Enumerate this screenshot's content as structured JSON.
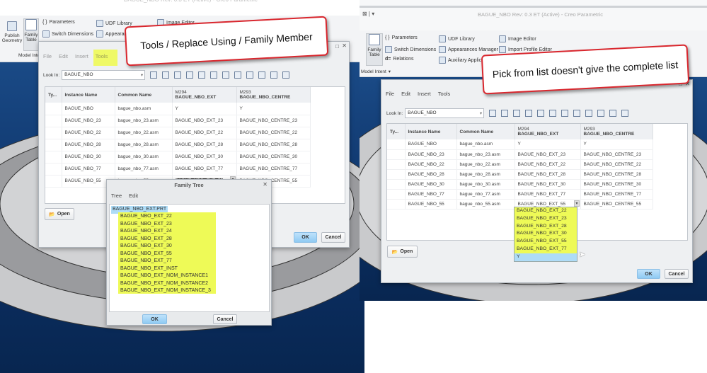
{
  "window_title": "BAGUE_NBO Rev: 0.3 ET (Active) - Creo Parametric",
  "ribbon": {
    "publish_geometry": "Publish Geometry",
    "family_table": "Family Table",
    "parameters": "Parameters",
    "switch_dimensions": "Switch Dimensions",
    "relations": "Relations",
    "udf_library": "UDF Library",
    "appearances_manager": "Appearances Manager",
    "appearances_short": "Appearan",
    "auxiliary_applications": "Auxiliary Applications",
    "image_editor": "Image Editor",
    "import_profile_editor": "Import Profile Editor",
    "model_intent": "Model Intent",
    "model_intent_short": "Model Inte"
  },
  "family_table_dialog": {
    "menu": [
      "File",
      "Edit",
      "Insert",
      "Tools"
    ],
    "look_in_label": "Look In:",
    "look_in_value": "BAGUE_NBO",
    "columns": [
      "Ty...",
      "Instance Name",
      "Common Name",
      "M294\nBAGUE_NBO_EXT",
      "M293\nBAGUE_NBO_CENTRE"
    ],
    "column_line1": [
      "Ty...",
      "Instance Name",
      "Common Name",
      "M294",
      "M293"
    ],
    "column_line2": [
      "",
      "",
      "",
      "BAGUE_NBO_EXT",
      "BAGUE_NBO_CENTRE"
    ],
    "rows": [
      [
        "",
        "BAGUE_NBO",
        "bague_nbo.asm",
        "Y",
        "Y"
      ],
      [
        "",
        "BAGUE_NBO_23",
        "bague_nbo_23.asm",
        "BAGUE_NBO_EXT_23",
        "BAGUE_NBO_CENTRE_23"
      ],
      [
        "",
        "BAGUE_NBO_22",
        "bague_nbo_22.asm",
        "BAGUE_NBO_EXT_22",
        "BAGUE_NBO_CENTRE_22"
      ],
      [
        "",
        "BAGUE_NBO_28",
        "bague_nbo_28.asm",
        "BAGUE_NBO_EXT_28",
        "BAGUE_NBO_CENTRE_28"
      ],
      [
        "",
        "BAGUE_NBO_30",
        "bague_nbo_30.asm",
        "BAGUE_NBO_EXT_30",
        "BAGUE_NBO_CENTRE_30"
      ],
      [
        "",
        "BAGUE_NBO_77",
        "bague_nbo_77.asm",
        "BAGUE_NBO_EXT_77",
        "BAGUE_NBO_CENTRE_77"
      ],
      [
        "",
        "BAGUE_NBO_55",
        "bague_nbo_55.asm",
        "BAGUE_NBO_EXT_55",
        "BAGUE_NBO_CENTRE_55"
      ]
    ],
    "open_label": "Open",
    "ok_label": "OK",
    "cancel_label": "Cancel"
  },
  "family_tree_dialog": {
    "title": "Family Tree",
    "menu": [
      "Tree",
      "Edit"
    ],
    "root": "BAGUE_NBO_EXT.PRT",
    "items": [
      "BAGUE_NBO_EXT_22",
      "BAGUE_NBO_EXT_23",
      "BAGUE_NBO_EXT_24",
      "BAGUE_NBO_EXT_28",
      "BAGUE_NBO_EXT_30",
      "BAGUE_NBO_EXT_55",
      "BAGUE_NBO_EXT_77",
      "BAGUE_NBO_EXT_INST",
      "BAGUE_NBO_EXT_NOM_INSTANCE1",
      "BAGUE_NBO_EXT_NOM_INSTANCE2",
      "BAGUE_NBO_EXT_NOM_INSTANCE_3"
    ],
    "ok_label": "OK",
    "cancel_label": "Cancel"
  },
  "dropdown_list": {
    "items": [
      "BAGUE_NBO_EXT_22",
      "BAGUE_NBO_EXT_23",
      "BAGUE_NBO_EXT_28",
      "BAGUE_NBO_EXT_30",
      "BAGUE_NBO_EXT_55",
      "BAGUE_NBO_EXT_77"
    ],
    "last_item": "Y"
  },
  "callouts": {
    "left": "Tools / Replace Using / Family Member",
    "right": "Pick from list doesn't give the complete list"
  },
  "colors": {
    "highlight": "#eefa57",
    "callout_border": "#d9272e",
    "selection": "#aedcf7"
  }
}
